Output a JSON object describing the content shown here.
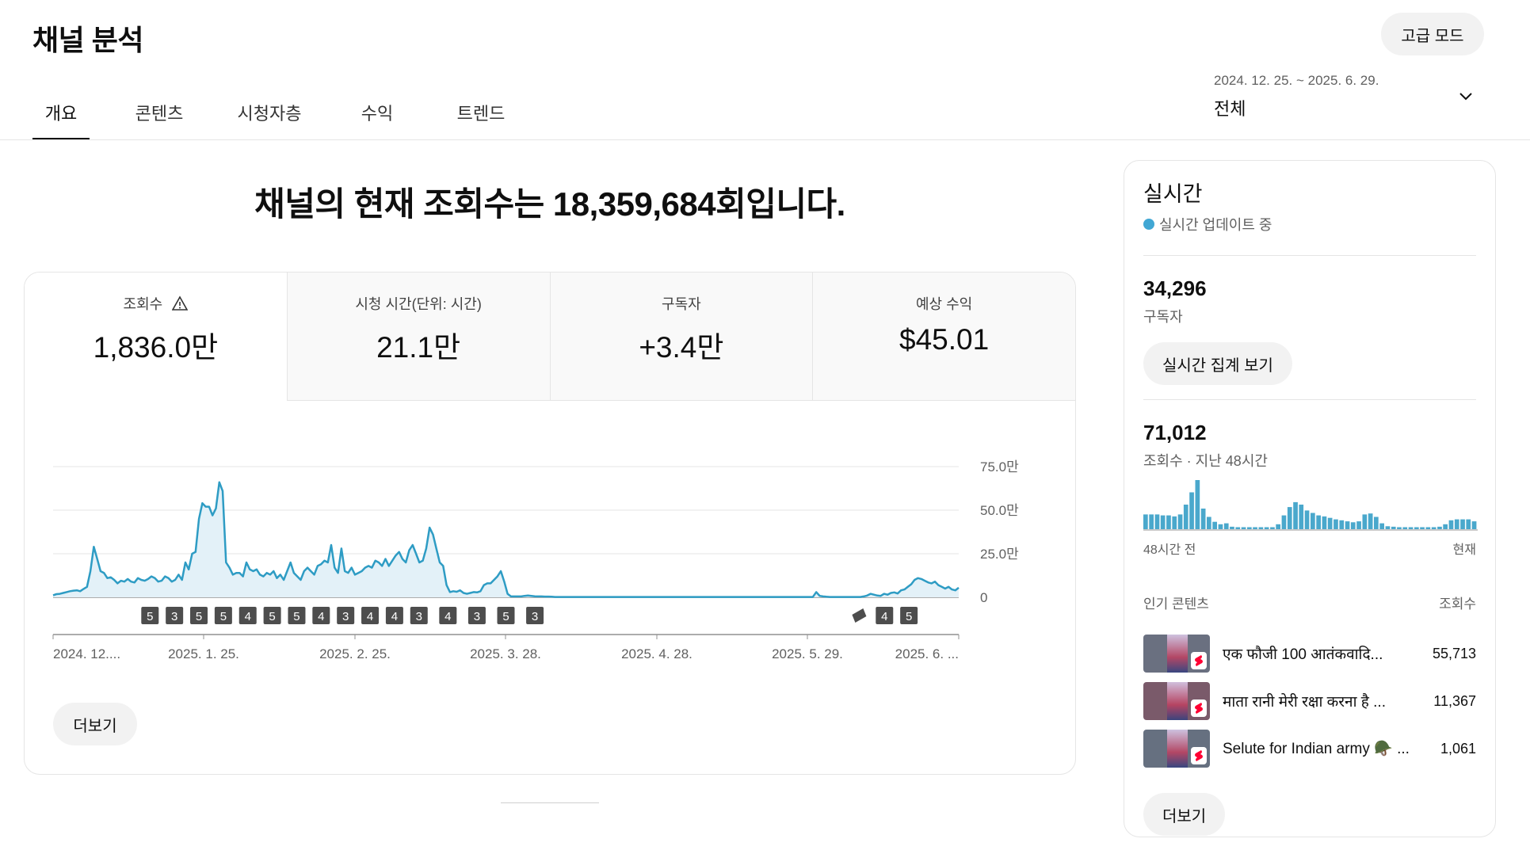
{
  "header": {
    "title": "채널 분석",
    "advanced_mode": "고급 모드"
  },
  "tabs": [
    {
      "label": "개요",
      "active": true
    },
    {
      "label": "콘텐츠",
      "active": false
    },
    {
      "label": "시청자층",
      "active": false
    },
    {
      "label": "수익",
      "active": false
    },
    {
      "label": "트렌드",
      "active": false
    }
  ],
  "date_range": {
    "range": "2024. 12. 25. ~ 2025. 6. 29.",
    "label": "전체"
  },
  "headline": "채널의 현재 조회수는 18,359,684회입니다.",
  "metrics": [
    {
      "label": "조회수",
      "value": "1,836.0만",
      "warning": true,
      "active": true
    },
    {
      "label": "시청 시간(단위: 시간)",
      "value": "21.1만",
      "warning": false,
      "active": false
    },
    {
      "label": "구독자",
      "value": "+3.4만",
      "warning": false,
      "active": false
    },
    {
      "label": "예상 수익",
      "value": "$45.01",
      "warning": false,
      "active": false
    }
  ],
  "chart_data": {
    "type": "area",
    "x_tick_labels": [
      "2024. 12....",
      "2025. 1. 25.",
      "2025. 2. 25.",
      "2025. 3. 28.",
      "2025. 4. 28.",
      "2025. 5. 29.",
      "2025. 6. ..."
    ],
    "y_tick_labels": [
      "0",
      "25.0만",
      "50.0만",
      "75.0만"
    ],
    "ylim": [
      0,
      750000
    ],
    "values": [
      12000,
      18000,
      20000,
      25000,
      30000,
      35000,
      38000,
      40000,
      35000,
      48000,
      60000,
      150000,
      290000,
      220000,
      150000,
      140000,
      110000,
      115000,
      100000,
      80000,
      95000,
      90000,
      105000,
      90000,
      85000,
      110000,
      100000,
      95000,
      105000,
      120000,
      110000,
      90000,
      95000,
      120000,
      110000,
      90000,
      100000,
      130000,
      100000,
      200000,
      160000,
      250000,
      260000,
      450000,
      540000,
      520000,
      520000,
      470000,
      510000,
      660000,
      610000,
      200000,
      170000,
      130000,
      140000,
      140000,
      120000,
      200000,
      160000,
      150000,
      160000,
      130000,
      120000,
      140000,
      130000,
      150000,
      110000,
      130000,
      100000,
      150000,
      200000,
      140000,
      120000,
      100000,
      150000,
      170000,
      150000,
      130000,
      180000,
      190000,
      210000,
      200000,
      300000,
      170000,
      140000,
      280000,
      150000,
      140000,
      170000,
      130000,
      140000,
      150000,
      170000,
      180000,
      170000,
      210000,
      200000,
      180000,
      220000,
      180000,
      210000,
      240000,
      260000,
      220000,
      200000,
      270000,
      300000,
      250000,
      200000,
      210000,
      280000,
      400000,
      360000,
      280000,
      200000,
      180000,
      70000,
      30000,
      35000,
      32000,
      40000,
      25000,
      20000,
      25000,
      30000,
      28000,
      35000,
      70000,
      80000,
      80000,
      100000,
      120000,
      150000,
      90000,
      20000,
      5000,
      5000,
      5000,
      5000,
      8000,
      10000,
      8000,
      6000,
      5000,
      5000,
      4000,
      4000,
      3000,
      2000,
      2000,
      2000,
      2000,
      2000,
      2000,
      2000,
      2000,
      2000,
      2000,
      2000,
      2000,
      2000,
      2000,
      2000,
      2000,
      2000,
      2000,
      2000,
      2000,
      2000,
      2000,
      2000,
      2000,
      2000,
      2000,
      2000,
      2000,
      2000,
      2000,
      2000,
      2000,
      2000,
      2000,
      2000,
      2000,
      2000,
      2000,
      2000,
      2000,
      2000,
      2000,
      2000,
      2000,
      2000,
      2000,
      2000,
      2000,
      2000,
      2000,
      2000,
      2000,
      2000,
      2000,
      2000,
      2000,
      2000,
      2000,
      2000,
      2000,
      2000,
      2000,
      2000,
      2000,
      2000,
      2000,
      2000,
      2000,
      2000,
      2000,
      2000,
      2000,
      2000,
      2000,
      2000,
      2000,
      2000,
      30000,
      8000,
      5000,
      3000,
      2000,
      2000,
      2000,
      2000,
      2000,
      2000,
      2000,
      2000,
      2000,
      2000,
      5000,
      10000,
      20000,
      15000,
      10000,
      8000,
      20000,
      15000,
      25000,
      28000,
      22000,
      40000,
      45000,
      60000,
      75000,
      100000,
      110000,
      105000,
      95000,
      85000,
      80000,
      90000,
      70000,
      60000,
      50000,
      60000,
      45000,
      40000,
      55000
    ],
    "upload_markers": {
      "labels": [
        "5",
        "3",
        "5",
        "5",
        "4",
        "5",
        "5",
        "4",
        "3",
        "4",
        "4",
        "3",
        "4",
        "3",
        "5",
        "3",
        "4",
        "5"
      ],
      "positions": [
        0.107,
        0.134,
        0.161,
        0.188,
        0.215,
        0.242,
        0.269,
        0.296,
        0.323,
        0.35,
        0.377,
        0.404,
        0.436,
        0.468,
        0.5,
        0.532,
        0.918,
        0.945
      ],
      "shorts_icon_position": 0.891
    }
  },
  "more_button": "더보기",
  "realtime": {
    "title": "실시간",
    "status": "실시간 업데이트 중",
    "subscribers": "34,296",
    "subscribers_label": "구독자",
    "view_button": "실시간 집계 보기",
    "views_48h": "71,012",
    "views_48h_label": "조회수 · 지난 48시간",
    "mini_bars": [
      0.3,
      0.3,
      0.3,
      0.28,
      0.28,
      0.26,
      0.3,
      0.5,
      0.75,
      1.0,
      0.42,
      0.25,
      0.15,
      0.1,
      0.12,
      0.05,
      0.04,
      0.04,
      0.04,
      0.04,
      0.04,
      0.04,
      0.04,
      0.1,
      0.28,
      0.45,
      0.55,
      0.5,
      0.38,
      0.33,
      0.28,
      0.26,
      0.23,
      0.2,
      0.18,
      0.16,
      0.14,
      0.16,
      0.3,
      0.32,
      0.25,
      0.12,
      0.06,
      0.05,
      0.04,
      0.04,
      0.04,
      0.04,
      0.04,
      0.04,
      0.04,
      0.05,
      0.1,
      0.18,
      0.2,
      0.2,
      0.2,
      0.16
    ],
    "mini_start": "48시간 전",
    "mini_end": "현재",
    "top_content_label": "인기 콘텐츠",
    "top_views_label": "조회수",
    "top_items": [
      {
        "title": "एक फौजी 100 आतंकवादि...",
        "views": "55,713",
        "thumb_color": "#6a7080"
      },
      {
        "title": "माता रानी मेरी रक्षा करना है ...",
        "views": "11,367",
        "thumb_color": "#7a5a6a"
      },
      {
        "title": "Selute for Indian army 🪖 ...",
        "views": "1,061",
        "thumb_color": "#667080"
      }
    ],
    "more_button": "더보기"
  },
  "colors": {
    "accent": "#4aa8cc",
    "line": "#2e9cc4",
    "area": "#e3f1f8"
  }
}
